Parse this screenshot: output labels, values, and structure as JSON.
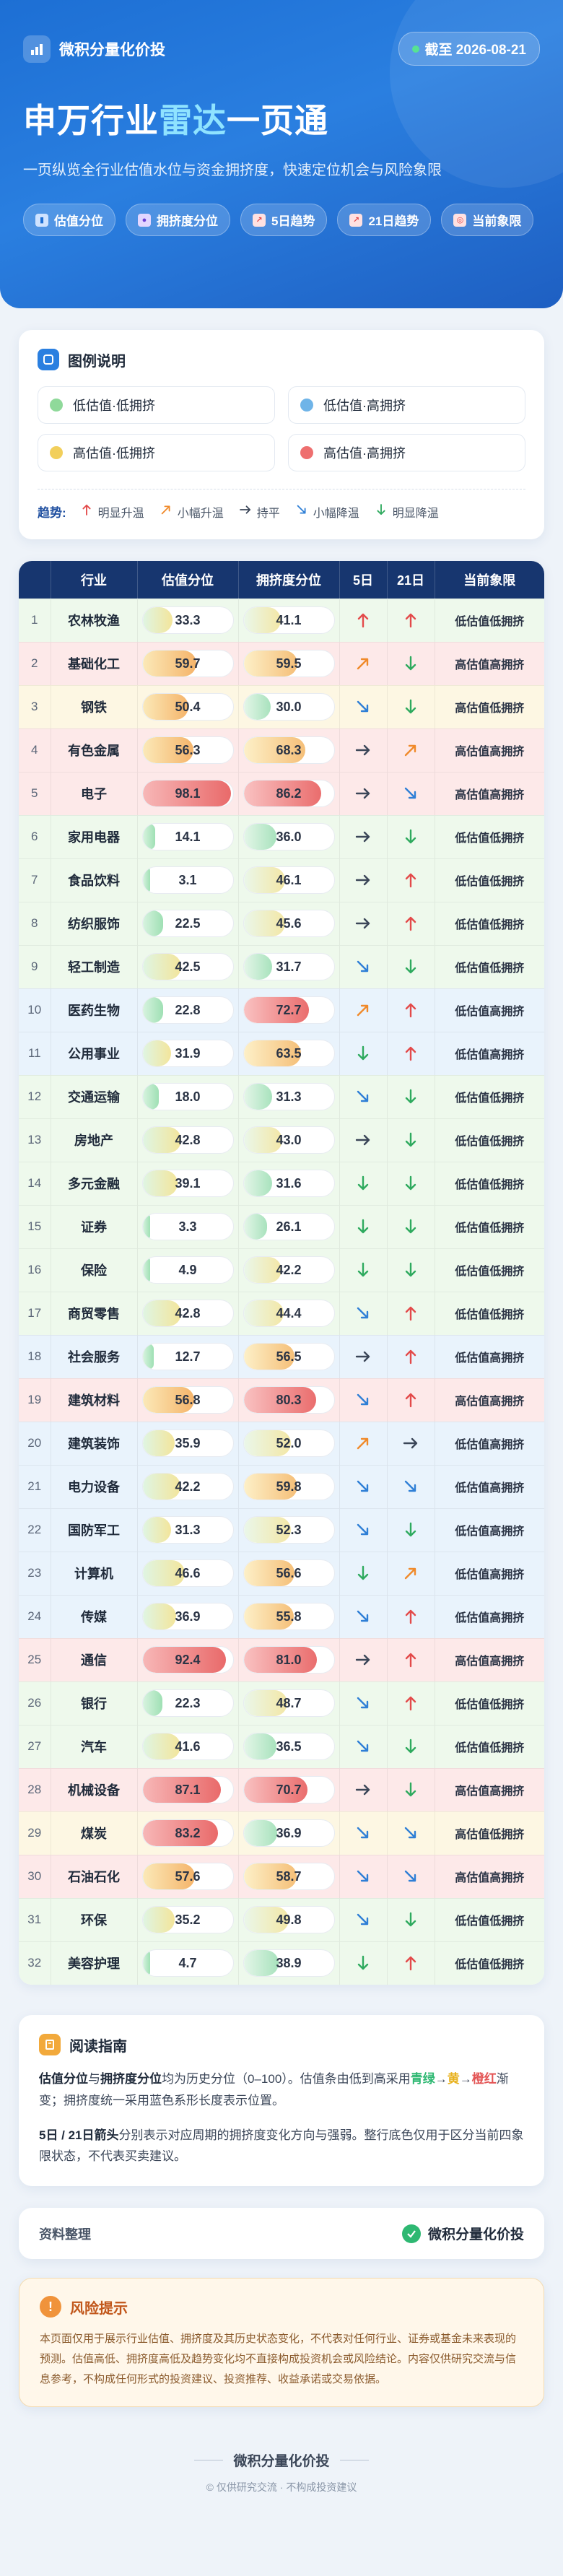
{
  "header": {
    "brand": "微积分量化价投",
    "date": "截至 2026-08-21",
    "title_pre": "申万行业",
    "title_accent": "雷达",
    "title_post": "一页通",
    "subtitle": "一页纵览全行业估值水位与资金拥挤度，快速定位机会与风险象限",
    "tags": [
      "估值分位",
      "拥挤度分位",
      "5日趋势",
      "21日趋势",
      "当前象限"
    ]
  },
  "legend": {
    "title": "图例说明",
    "items": [
      {
        "label": "低估值·低拥挤",
        "color": "#8fd99a"
      },
      {
        "label": "低估值·高拥挤",
        "color": "#6fb4e8"
      },
      {
        "label": "高估值·低拥挤",
        "color": "#f2cf5b"
      },
      {
        "label": "高估值·高拥挤",
        "color": "#ee6f6f"
      }
    ],
    "trend_title": "趋势:",
    "trends": [
      {
        "label": "明显升温",
        "dir": "up"
      },
      {
        "label": "小幅升温",
        "dir": "up-right"
      },
      {
        "label": "持平",
        "dir": "right"
      },
      {
        "label": "小幅降温",
        "dir": "down-right"
      },
      {
        "label": "明显降温",
        "dir": "down"
      }
    ]
  },
  "table": {
    "headers": [
      "",
      "行业",
      "估值分位",
      "拥挤度分位",
      "5日",
      "21日",
      "当前象限"
    ],
    "rows": [
      {
        "i": "1",
        "n": "农林牧渔",
        "v": 33.3,
        "c": 41.1,
        "t5": "up",
        "t21": "up",
        "q": "低估值低拥挤"
      },
      {
        "i": "2",
        "n": "基础化工",
        "v": 59.7,
        "c": 59.5,
        "t5": "up-right",
        "t21": "down",
        "q": "高估值高拥挤"
      },
      {
        "i": "3",
        "n": "钢铁",
        "v": 50.4,
        "c": 30.0,
        "t5": "down-right",
        "t21": "down",
        "q": "高估值低拥挤"
      },
      {
        "i": "4",
        "n": "有色金属",
        "v": 56.3,
        "c": 68.3,
        "t5": "right",
        "t21": "up-right",
        "q": "高估值高拥挤"
      },
      {
        "i": "5",
        "n": "电子",
        "v": 98.1,
        "c": 86.2,
        "t5": "right",
        "t21": "down-right",
        "q": "高估值高拥挤"
      },
      {
        "i": "6",
        "n": "家用电器",
        "v": 14.1,
        "c": 36.0,
        "t5": "right",
        "t21": "down",
        "q": "低估值低拥挤"
      },
      {
        "i": "7",
        "n": "食品饮料",
        "v": 3.1,
        "c": 46.1,
        "t5": "right",
        "t21": "up",
        "q": "低估值低拥挤"
      },
      {
        "i": "8",
        "n": "纺织服饰",
        "v": 22.5,
        "c": 45.6,
        "t5": "right",
        "t21": "up",
        "q": "低估值低拥挤"
      },
      {
        "i": "9",
        "n": "轻工制造",
        "v": 42.5,
        "c": 31.7,
        "t5": "down-right",
        "t21": "down",
        "q": "低估值低拥挤"
      },
      {
        "i": "10",
        "n": "医药生物",
        "v": 22.8,
        "c": 72.7,
        "t5": "up-right",
        "t21": "up",
        "q": "低估值高拥挤"
      },
      {
        "i": "11",
        "n": "公用事业",
        "v": 31.9,
        "c": 63.5,
        "t5": "down",
        "t21": "up",
        "q": "低估值高拥挤"
      },
      {
        "i": "12",
        "n": "交通运输",
        "v": 18.0,
        "c": 31.3,
        "t5": "down-right",
        "t21": "down",
        "q": "低估值低拥挤"
      },
      {
        "i": "13",
        "n": "房地产",
        "v": 42.8,
        "c": 43.0,
        "t5": "right",
        "t21": "down",
        "q": "低估值低拥挤"
      },
      {
        "i": "14",
        "n": "多元金融",
        "v": 39.1,
        "c": 31.6,
        "t5": "down",
        "t21": "down",
        "q": "低估值低拥挤"
      },
      {
        "i": "15",
        "n": "证券",
        "v": 3.3,
        "c": 26.1,
        "t5": "down",
        "t21": "down",
        "q": "低估值低拥挤"
      },
      {
        "i": "16",
        "n": "保险",
        "v": 4.9,
        "c": 42.2,
        "t5": "down",
        "t21": "down",
        "q": "低估值低拥挤"
      },
      {
        "i": "17",
        "n": "商贸零售",
        "v": 42.8,
        "c": 44.4,
        "t5": "down-right",
        "t21": "up",
        "q": "低估值低拥挤"
      },
      {
        "i": "18",
        "n": "社会服务",
        "v": 12.7,
        "c": 56.5,
        "t5": "right",
        "t21": "up",
        "q": "低估值高拥挤"
      },
      {
        "i": "19",
        "n": "建筑材料",
        "v": 56.8,
        "c": 80.3,
        "t5": "down-right",
        "t21": "up",
        "q": "高估值高拥挤"
      },
      {
        "i": "20",
        "n": "建筑装饰",
        "v": 35.9,
        "c": 52.0,
        "t5": "up-right",
        "t21": "right",
        "q": "低估值高拥挤"
      },
      {
        "i": "21",
        "n": "电力设备",
        "v": 42.2,
        "c": 59.8,
        "t5": "down-right",
        "t21": "down-right",
        "q": "低估值高拥挤"
      },
      {
        "i": "22",
        "n": "国防军工",
        "v": 31.3,
        "c": 52.3,
        "t5": "down-right",
        "t21": "down",
        "q": "低估值高拥挤"
      },
      {
        "i": "23",
        "n": "计算机",
        "v": 46.6,
        "c": 56.6,
        "t5": "down",
        "t21": "up-right",
        "q": "低估值高拥挤"
      },
      {
        "i": "24",
        "n": "传媒",
        "v": 36.9,
        "c": 55.8,
        "t5": "down-right",
        "t21": "up",
        "q": "低估值高拥挤"
      },
      {
        "i": "25",
        "n": "通信",
        "v": 92.4,
        "c": 81.0,
        "t5": "right",
        "t21": "up",
        "q": "高估值高拥挤"
      },
      {
        "i": "26",
        "n": "银行",
        "v": 22.3,
        "c": 48.7,
        "t5": "down-right",
        "t21": "up",
        "q": "低估值低拥挤"
      },
      {
        "i": "27",
        "n": "汽车",
        "v": 41.6,
        "c": 36.5,
        "t5": "down-right",
        "t21": "down",
        "q": "低估值低拥挤"
      },
      {
        "i": "28",
        "n": "机械设备",
        "v": 87.1,
        "c": 70.7,
        "t5": "right",
        "t21": "down",
        "q": "高估值高拥挤"
      },
      {
        "i": "29",
        "n": "煤炭",
        "v": 83.2,
        "c": 36.9,
        "t5": "down-right",
        "t21": "down-right",
        "q": "高估值低拥挤"
      },
      {
        "i": "30",
        "n": "石油石化",
        "v": 57.6,
        "c": 58.7,
        "t5": "down-right",
        "t21": "down-right",
        "q": "高估值高拥挤"
      },
      {
        "i": "31",
        "n": "环保",
        "v": 35.2,
        "c": 49.8,
        "t5": "down-right",
        "t21": "down",
        "q": "低估值低拥挤"
      },
      {
        "i": "32",
        "n": "美容护理",
        "v": 4.7,
        "c": 38.9,
        "t5": "down",
        "t21": "up",
        "q": "低估值低拥挤"
      }
    ]
  },
  "quadrant_colors": {
    "低估值低拥挤": "#eef9ec",
    "低估值高拥挤": "#e9f3fc",
    "高估值低拥挤": "#fdf7e3",
    "高估值高拥挤": "#fde9e9"
  },
  "arrow_colors": {
    "up": "#e34a4a",
    "up-right": "#f08a2a",
    "right": "#3b4658",
    "down-right": "#2f7fd6",
    "down": "#2eaa5e"
  },
  "guide": {
    "title": "阅读指南",
    "p1_a": "估值分位",
    "p1_b": "与",
    "p1_c": "拥挤度分位",
    "p1_d": "均为历史分位（0–100）。估值条由低到高采用",
    "p1_green": "青绿",
    "p1_arrow1": "→",
    "p1_yellow": "黄",
    "p1_arrow2": "→",
    "p1_red": "橙红",
    "p1_e": "渐变；拥挤度统一采用蓝色系形长度表示位置。",
    "p2_a": "5日 / 21日箭头",
    "p2_b": "分别表示对应周期的拥挤度变化方向与强弱。整行底色仅用于区分当前四象限状态，不代表买卖建议。"
  },
  "source": {
    "left": "资料整理",
    "right": "微积分量化价投"
  },
  "risk": {
    "title": "风险提示",
    "text": "本页面仅用于展示行业估值、拥挤度及其历史状态变化，不代表对任何行业、证券或基金未来表现的预测。估值高低、拥挤度高低及趋势变化均不直接构成投资机会或风险结论。内容仅供研究交流与信息参考，不构成任何形式的投资建议、投资推荐、收益承诺或交易依据。"
  },
  "footer": {
    "brand": "微积分量化价投",
    "sub": "© 仅供研究交流 · 不构成投资建议"
  }
}
